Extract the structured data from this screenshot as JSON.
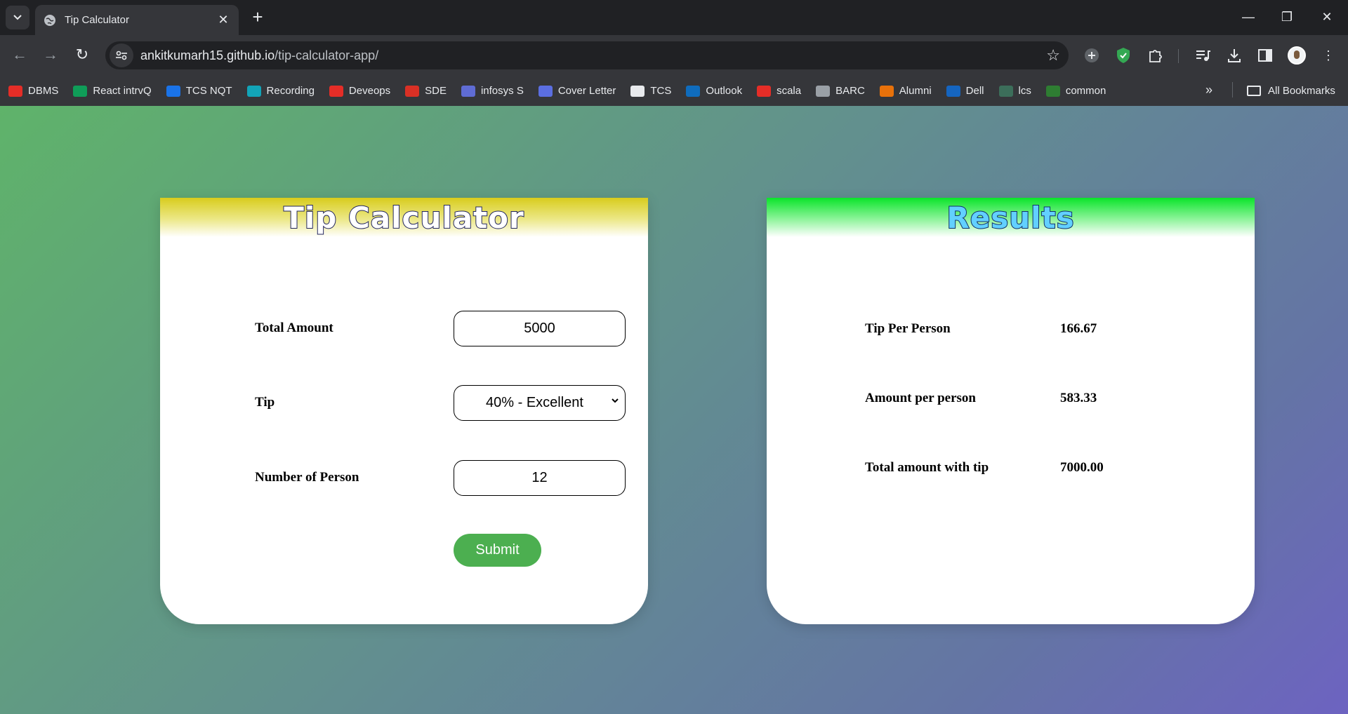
{
  "browser": {
    "tab_title": "Tip Calculator",
    "url_host": "ankitkumarh15.github.io",
    "url_path": "/tip-calculator-app/",
    "bookmarks": [
      {
        "label": "DBMS",
        "color": "#e52d27"
      },
      {
        "label": "React intrvQ",
        "color": "#0f9d58"
      },
      {
        "label": "TCS NQT",
        "color": "#1a73e8"
      },
      {
        "label": "Recording",
        "color": "#12a4b8"
      },
      {
        "label": "Deveops",
        "color": "#e52d27"
      },
      {
        "label": "SDE",
        "color": "#d93025"
      },
      {
        "label": "infosys S",
        "color": "#5f6cd4"
      },
      {
        "label": "Cover Letter",
        "color": "#5b6ee1"
      },
      {
        "label": "TCS",
        "color": "#e8eaed"
      },
      {
        "label": "Outlook",
        "color": "#0f6cbd"
      },
      {
        "label": "scala",
        "color": "#e52d27"
      },
      {
        "label": "BARC",
        "color": "#9aa0a6"
      },
      {
        "label": "Alumni",
        "color": "#e8710a"
      },
      {
        "label": "Dell",
        "color": "#1565c0"
      },
      {
        "label": "lcs",
        "color": "#3c6e5a"
      },
      {
        "label": "common",
        "color": "#2e7d32"
      }
    ],
    "all_bookmarks_label": "All Bookmarks"
  },
  "calculator": {
    "title": "Tip Calculator",
    "total_amount_label": "Total Amount",
    "total_amount_value": "5000",
    "tip_label": "Tip",
    "tip_selected": "40% - Excellent",
    "persons_label": "Number of Person",
    "persons_value": "12",
    "submit_label": "Submit"
  },
  "results": {
    "title": "Results",
    "tip_per_person_label": "Tip Per Person",
    "tip_per_person_value": "166.67",
    "amount_per_person_label": "Amount per person",
    "amount_per_person_value": "583.33",
    "total_with_tip_label": "Total amount with tip",
    "total_with_tip_value": "7000.00"
  },
  "colors": {
    "submit": "#4caf50",
    "calc_header": "#d8cc1d",
    "results_header": "#0ae42a"
  }
}
